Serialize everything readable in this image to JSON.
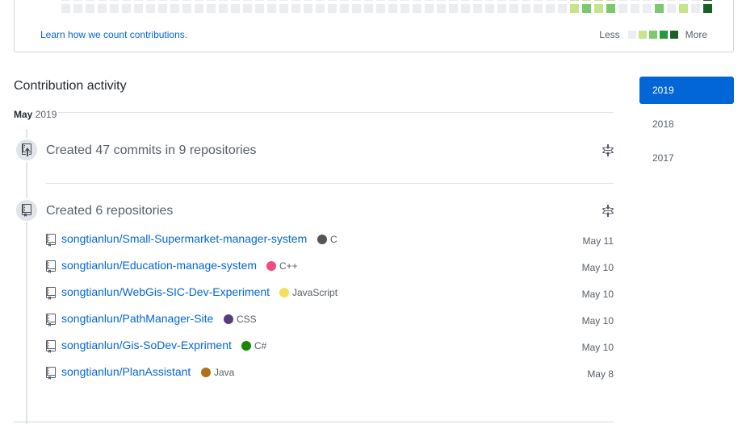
{
  "graph": {
    "learn_link": "Learn how we count contributions.",
    "legend_less": "Less",
    "legend_more": "More",
    "colors": [
      "#ebedf0",
      "#c6e48b",
      "#7bc96f",
      "#239a3b",
      "#196127"
    ],
    "last_row_levels": [
      0,
      0,
      0,
      0,
      0,
      0,
      0,
      0,
      0,
      0,
      0,
      0,
      0,
      0,
      0,
      0,
      0,
      0,
      0,
      0,
      0,
      0,
      0,
      0,
      0,
      0,
      0,
      0,
      0,
      0,
      0,
      0,
      0,
      0,
      0,
      0,
      0,
      0,
      0,
      0,
      0,
      0,
      1,
      2,
      1,
      2,
      0,
      0,
      0,
      2,
      0,
      1,
      0,
      4
    ]
  },
  "activity": {
    "title": "Contribution activity",
    "month": "May",
    "year": "2019"
  },
  "events": [
    {
      "icon": "repo-push-icon",
      "title": "Created 47 commits in 9 repositories"
    },
    {
      "icon": "repo-icon",
      "title": "Created 6 repositories",
      "repos": [
        {
          "name": "songtianlun/Small-Supermarket-manager-system",
          "language": "C",
          "color": "#555555",
          "date": "May 11"
        },
        {
          "name": "songtianlun/Education-manage-system",
          "language": "C++",
          "color": "#f34b7d",
          "date": "May 10"
        },
        {
          "name": "songtianlun/WebGis-SIC-Dev-Experiment",
          "language": "JavaScript",
          "color": "#f1e05a",
          "date": "May 10"
        },
        {
          "name": "songtianlun/PathManager-Site",
          "language": "CSS",
          "color": "#563d7c",
          "date": "May 10"
        },
        {
          "name": "songtianlun/Gis-SoDev-Expriment",
          "language": "C#",
          "color": "#178600",
          "date": "May 10"
        },
        {
          "name": "songtianlun/PlanAssistant",
          "language": "Java",
          "color": "#b07219",
          "date": "May 8"
        }
      ]
    }
  ],
  "years": [
    {
      "label": "2019",
      "selected": true
    },
    {
      "label": "2018",
      "selected": false
    },
    {
      "label": "2017",
      "selected": false
    }
  ]
}
